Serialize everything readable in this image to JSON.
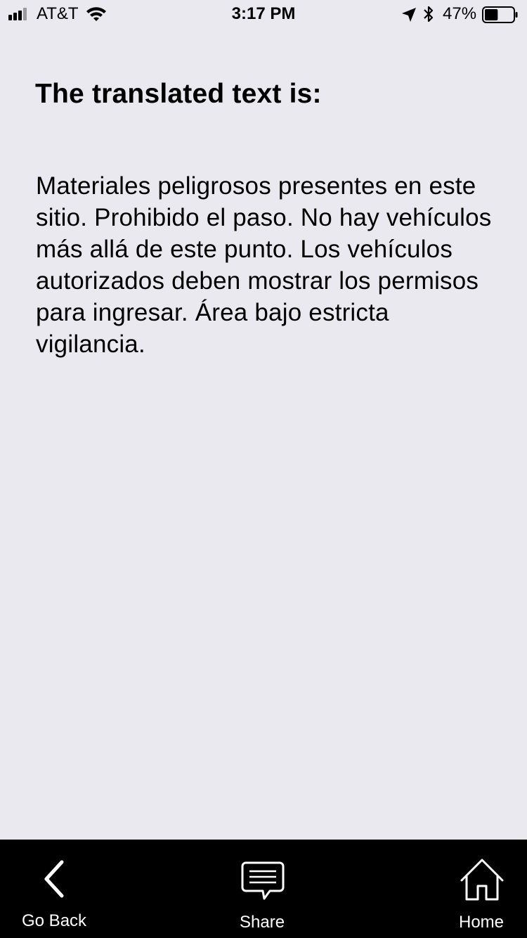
{
  "status_bar": {
    "carrier": "AT&T",
    "time": "3:17 PM",
    "battery_percent": "47%",
    "battery_level": 0.47,
    "signal_icon": "cellular-signal-icon",
    "wifi_icon": "wifi-icon",
    "location_icon": "location-arrow-icon",
    "bluetooth_icon": "bluetooth-icon",
    "battery_icon": "battery-icon"
  },
  "main": {
    "heading": "The translated text is:",
    "translated_text": "Materiales peligrosos presentes en este sitio. Prohibido el paso. No hay vehículos más allá de este punto. Los vehículos autorizados deben mostrar los permisos para ingresar. Área bajo estricta vigilancia."
  },
  "tab_bar": {
    "items": [
      {
        "label": "Go Back",
        "icon": "chevron-left-icon"
      },
      {
        "label": "Share",
        "icon": "speech-bubble-icon"
      },
      {
        "label": "Home",
        "icon": "house-icon"
      }
    ]
  },
  "colors": {
    "background": "#e9e9ef",
    "tab_bar_background": "#000000",
    "tab_bar_foreground": "#ffffff",
    "text": "#000000"
  }
}
